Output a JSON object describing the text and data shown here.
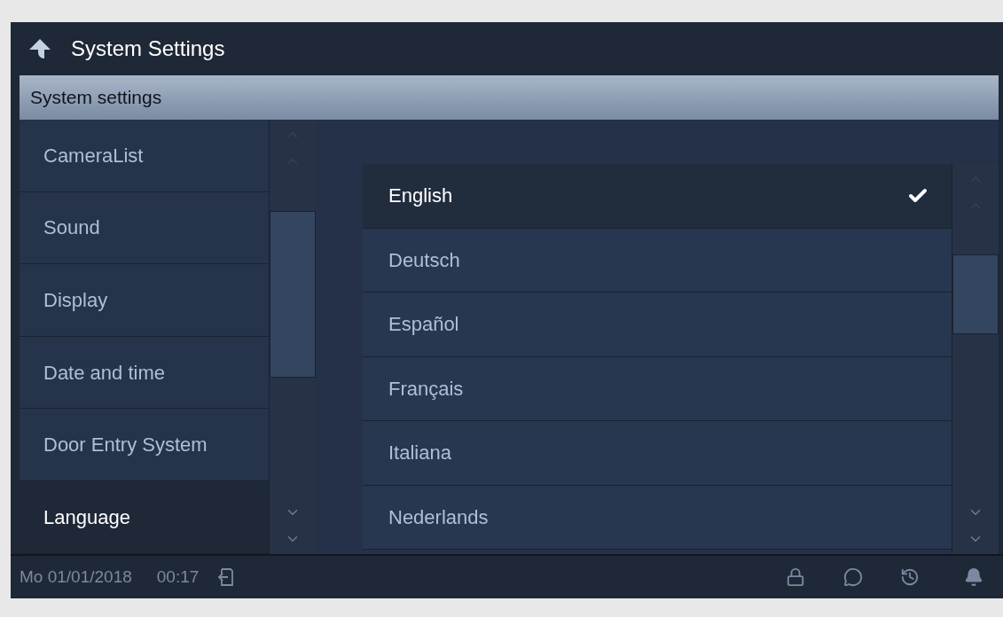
{
  "header": {
    "title": "System Settings"
  },
  "section": {
    "title": "System settings"
  },
  "sidebar": {
    "items": [
      {
        "label": "CameraList",
        "selected": false
      },
      {
        "label": "Sound",
        "selected": false
      },
      {
        "label": "Display",
        "selected": false
      },
      {
        "label": "Date and time",
        "selected": false
      },
      {
        "label": "Door Entry System",
        "selected": false
      },
      {
        "label": "Language",
        "selected": true
      }
    ]
  },
  "languages": [
    {
      "label": "English",
      "selected": true
    },
    {
      "label": "Deutsch",
      "selected": false
    },
    {
      "label": "Español",
      "selected": false
    },
    {
      "label": "Français",
      "selected": false
    },
    {
      "label": "Italiana",
      "selected": false
    },
    {
      "label": "Nederlands",
      "selected": false
    }
  ],
  "status_bar": {
    "date": "Mo 01/01/2018",
    "time": "00:17"
  }
}
